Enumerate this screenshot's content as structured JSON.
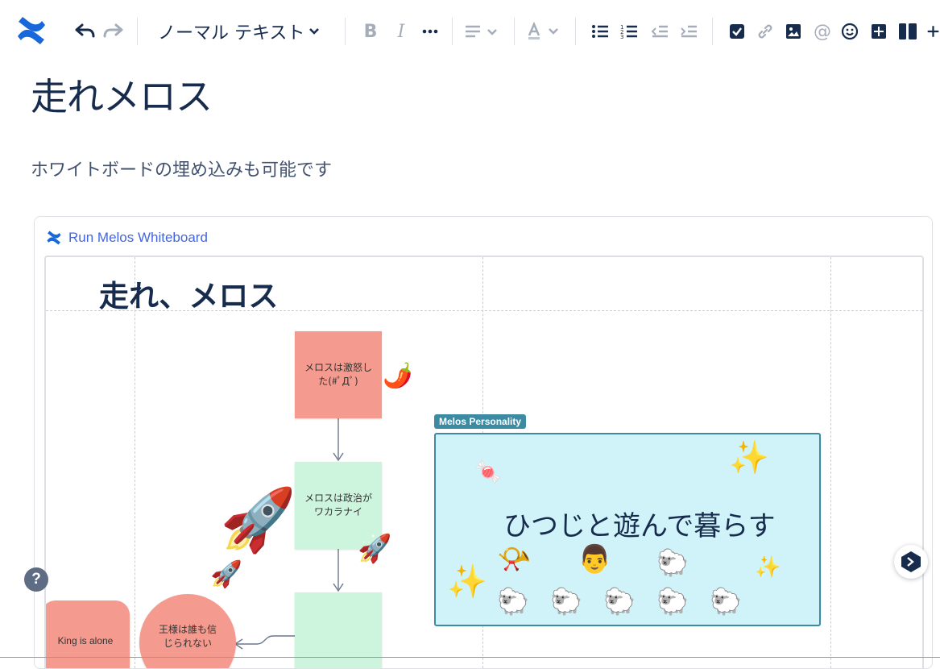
{
  "toolbar": {
    "text_style": "ノーマル テキスト",
    "icons": [
      "confluence-logo",
      "undo",
      "redo",
      "bold",
      "italic",
      "more",
      "align",
      "text-color",
      "bullet-list",
      "numbered-list",
      "outdent",
      "indent",
      "task",
      "link",
      "image",
      "mention",
      "emoji",
      "table",
      "layout",
      "insert"
    ]
  },
  "page": {
    "title": "走れメロス",
    "paragraph": "ホワイトボードの埋め込みも可能です"
  },
  "embed": {
    "link_label": "Run Melos Whiteboard",
    "whiteboard": {
      "title": "走れ、メロス",
      "stickies": {
        "angry": "メロスは激怒した(#ﾟДﾟ)",
        "politics": "メロスは政治がワカラナイ",
        "king_alone": "King is alone",
        "king_trust": "王様は誰も信じられない"
      },
      "frame": {
        "label": "Melos Personality",
        "text": "ひつじと遊んで暮らす"
      }
    }
  },
  "colors": {
    "sticky_red": "#F49A8E",
    "sticky_green": "#CDF5DE",
    "frame_bg": "#CFF3F9",
    "frame_border": "#3C8BA3",
    "link": "#4466DD"
  },
  "help": {
    "label": "?"
  }
}
